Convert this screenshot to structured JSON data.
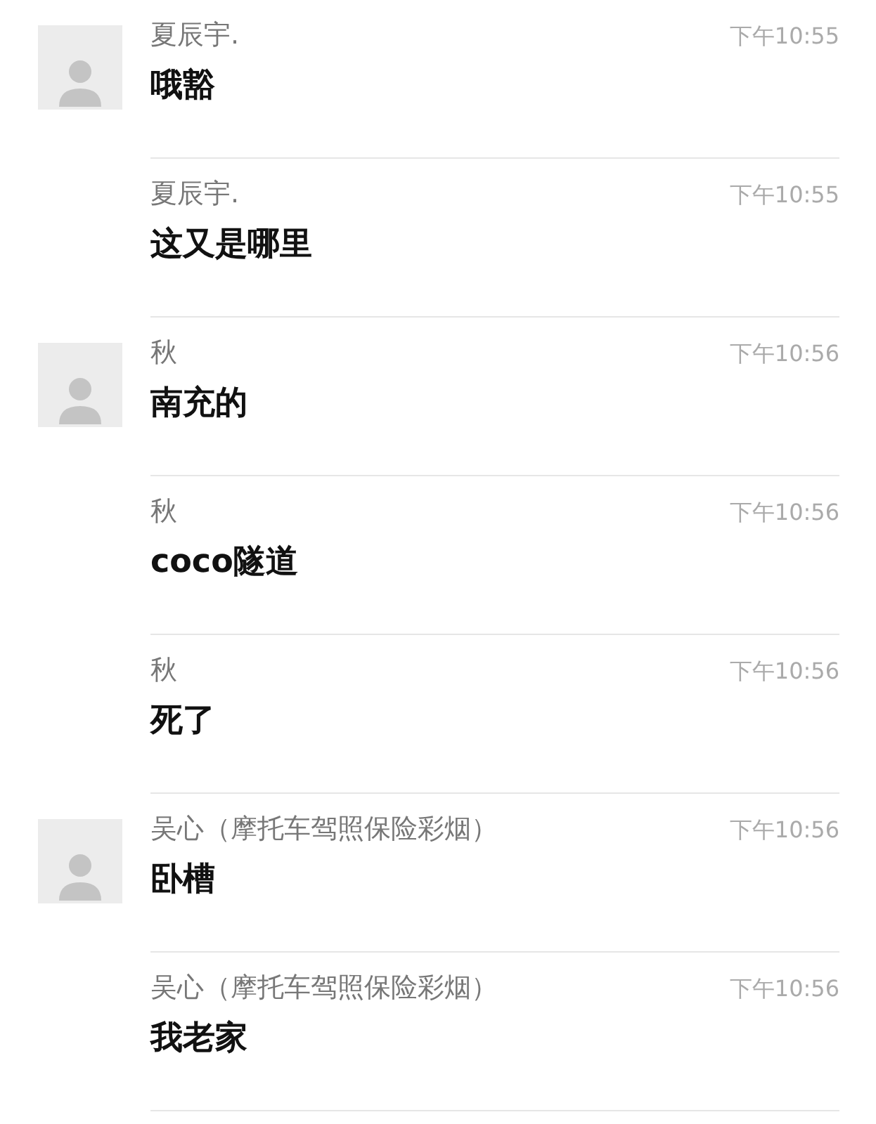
{
  "messages": [
    {
      "sender": "夏辰宇.",
      "time": "下午10:55",
      "text": "哦豁",
      "show_avatar": true
    },
    {
      "sender": "夏辰宇.",
      "time": "下午10:55",
      "text": "这又是哪里",
      "show_avatar": false
    },
    {
      "sender": "秋",
      "time": "下午10:56",
      "text": "南充的",
      "show_avatar": true
    },
    {
      "sender": "秋",
      "time": "下午10:56",
      "text": "coco隧道",
      "show_avatar": false
    },
    {
      "sender": "秋",
      "time": "下午10:56",
      "text": "死了",
      "show_avatar": false
    },
    {
      "sender": "吴心（摩托车驾照保险彩烟）",
      "time": "下午10:56",
      "text": "卧槽",
      "show_avatar": true
    },
    {
      "sender": "吴心（摩托车驾照保险彩烟）",
      "time": "下午10:56",
      "text": "我老家",
      "show_avatar": false
    }
  ]
}
